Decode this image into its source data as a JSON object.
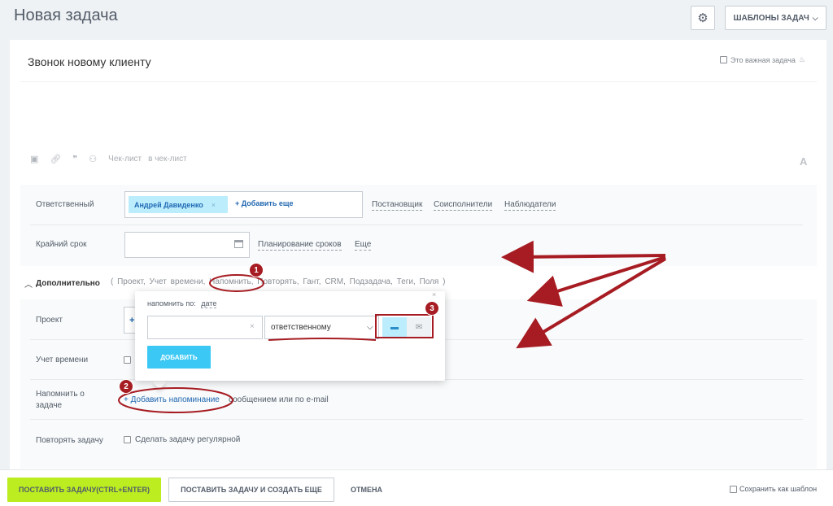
{
  "header": {
    "title": "Новая задача",
    "templates_label": "ШАБЛОНЫ ЗАДАЧ"
  },
  "task": {
    "title": "Звонок новому клиенту",
    "important_label": "Это важная задача"
  },
  "editor": {
    "checklist_label": "Чек-лист",
    "in_checklist_label": "в чек-лист",
    "font_label": "A"
  },
  "responsible": {
    "label": "Ответственный",
    "user": "Андрей Давиденко",
    "add_more": "+ Добавить еще",
    "links": [
      "Постановщик",
      "Соисполнители",
      "Наблюдатели"
    ]
  },
  "deadline": {
    "label": "Крайний срок",
    "links": [
      "Планирование сроков",
      "Еще"
    ]
  },
  "additional": {
    "label": "Дополнительно",
    "links_text": "( Проект, Учет времени, Напомнить, Повторять, Гант, CRM, Подзадача, Теги, Поля )"
  },
  "fields": {
    "project_label": "Проект",
    "project_add": "+",
    "time_label": "Учет времени",
    "remind_label": "Напомнить о задаче",
    "add_reminder": "+ Добавить напоминание",
    "remind_rest": "сообщением или по e-mail",
    "repeat_label": "Повторять задачу",
    "repeat_option": "Сделать задачу регулярной"
  },
  "popup": {
    "remind_by_label": "напомнить по:",
    "remind_by_value": "дате",
    "recipient": "ответственному",
    "add_button": "ДОБАВИТЬ",
    "close": "×"
  },
  "footer": {
    "submit": "ПОСТАВИТЬ ЗАДАЧУ(CTRL+ENTER)",
    "submit_more": "ПОСТАВИТЬ ЗАДАЧУ И СОЗДАТЬ ЕЩЕ",
    "cancel": "ОТМЕНА",
    "save_template": "Сохранить как шаблон"
  },
  "annotations": {
    "badges": [
      "1",
      "2",
      "3"
    ],
    "color": "#a61c22"
  },
  "colors": {
    "accent_green": "#bbed21",
    "accent_blue": "#3bc8f5",
    "chip_blue": "#bcedfc"
  }
}
